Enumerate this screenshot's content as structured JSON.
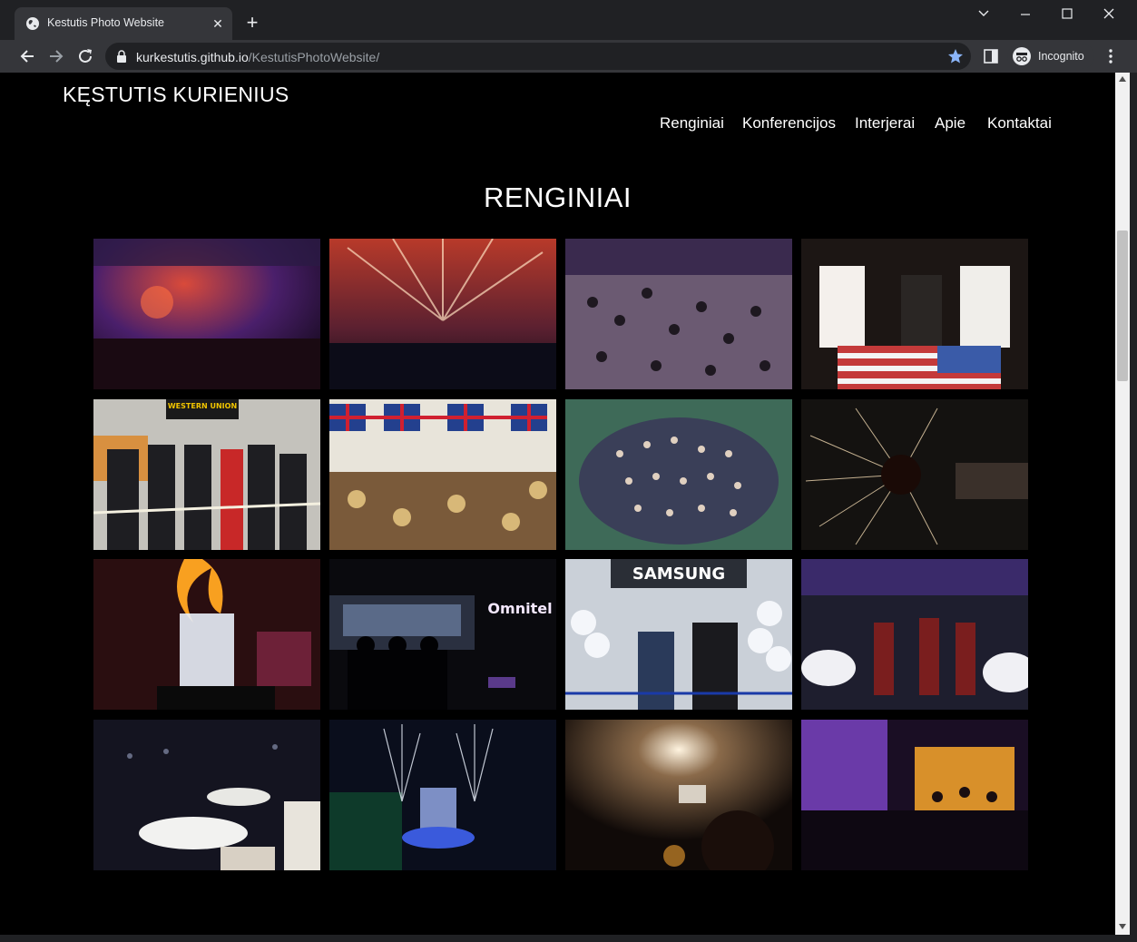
{
  "browser": {
    "tab_title": "Kestutis Photo Website",
    "url_host": "kurkestutis.github.io",
    "url_path": "/KestutisPhotoWebsite/",
    "incognito_label": "Incognito",
    "accent": "#8ab4f8"
  },
  "site": {
    "title": "KĘSTUTIS KURIENIUS",
    "nav": [
      "Renginiai",
      "Konferencijos",
      "Interjerai",
      "Apie",
      "Kontaktai"
    ],
    "heading": "RENGINIAI"
  },
  "gallery": {
    "photo_signs": {
      "western_union": "WESTERN UNION",
      "omnitel": "Omnitel",
      "samsung": "SAMSUNG"
    }
  }
}
